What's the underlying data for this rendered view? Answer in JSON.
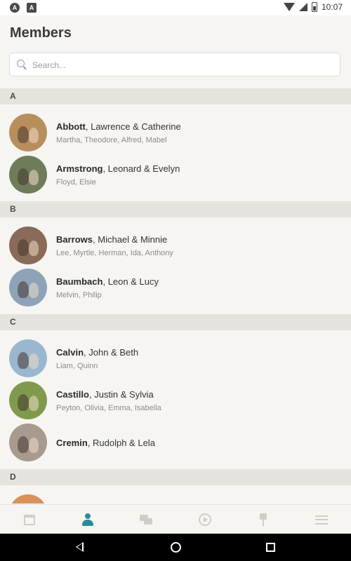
{
  "statusbar": {
    "time": "10:07"
  },
  "header": {
    "title": "Members"
  },
  "search": {
    "placeholder": "Search..."
  },
  "sections": [
    {
      "letter": "A",
      "members": [
        {
          "surname": "Abbott",
          "rest": ", Lawrence & Catherine",
          "children": "Martha, Theodore, Alfred, Mabel",
          "color": "#b98e5d"
        },
        {
          "surname": "Armstrong",
          "rest": ", Leonard & Evelyn",
          "children": "Floyd, Elsie",
          "color": "#6f7c5a"
        }
      ]
    },
    {
      "letter": "B",
      "members": [
        {
          "surname": "Barrows",
          "rest": ", Michael & Minnie",
          "children": "Lee, Myrtle, Herman, Ida, Anthony",
          "color": "#8a6a58"
        },
        {
          "surname": "Baumbach",
          "rest": ", Leon & Lucy",
          "children": "Melvin, Philip",
          "color": "#8fa3b8"
        }
      ]
    },
    {
      "letter": "C",
      "members": [
        {
          "surname": "Calvin",
          "rest": ", John & Beth",
          "children": "Liam, Quinn",
          "color": "#9bb7cf"
        },
        {
          "surname": "Castillo",
          "rest": ", Justin & Sylvia",
          "children": "Peyton, Olivia, Emma, Isabella",
          "color": "#7f9a4d"
        },
        {
          "surname": "Cremin",
          "rest": ", Rudolph & Lela",
          "children": "",
          "color": "#a79a8e"
        }
      ]
    },
    {
      "letter": "D",
      "members": [
        {
          "surname": "",
          "rest": "",
          "children": "",
          "color": "#d9905a"
        }
      ]
    }
  ],
  "bottom_nav": {
    "items": [
      {
        "icon": "calendar-icon",
        "active": false
      },
      {
        "icon": "person-icon",
        "active": true,
        "active_color": "#2a8c97"
      },
      {
        "icon": "chat-icon",
        "active": false
      },
      {
        "icon": "play-icon",
        "active": false
      },
      {
        "icon": "pin-icon",
        "active": false
      },
      {
        "icon": "menu-icon",
        "active": false
      }
    ]
  }
}
